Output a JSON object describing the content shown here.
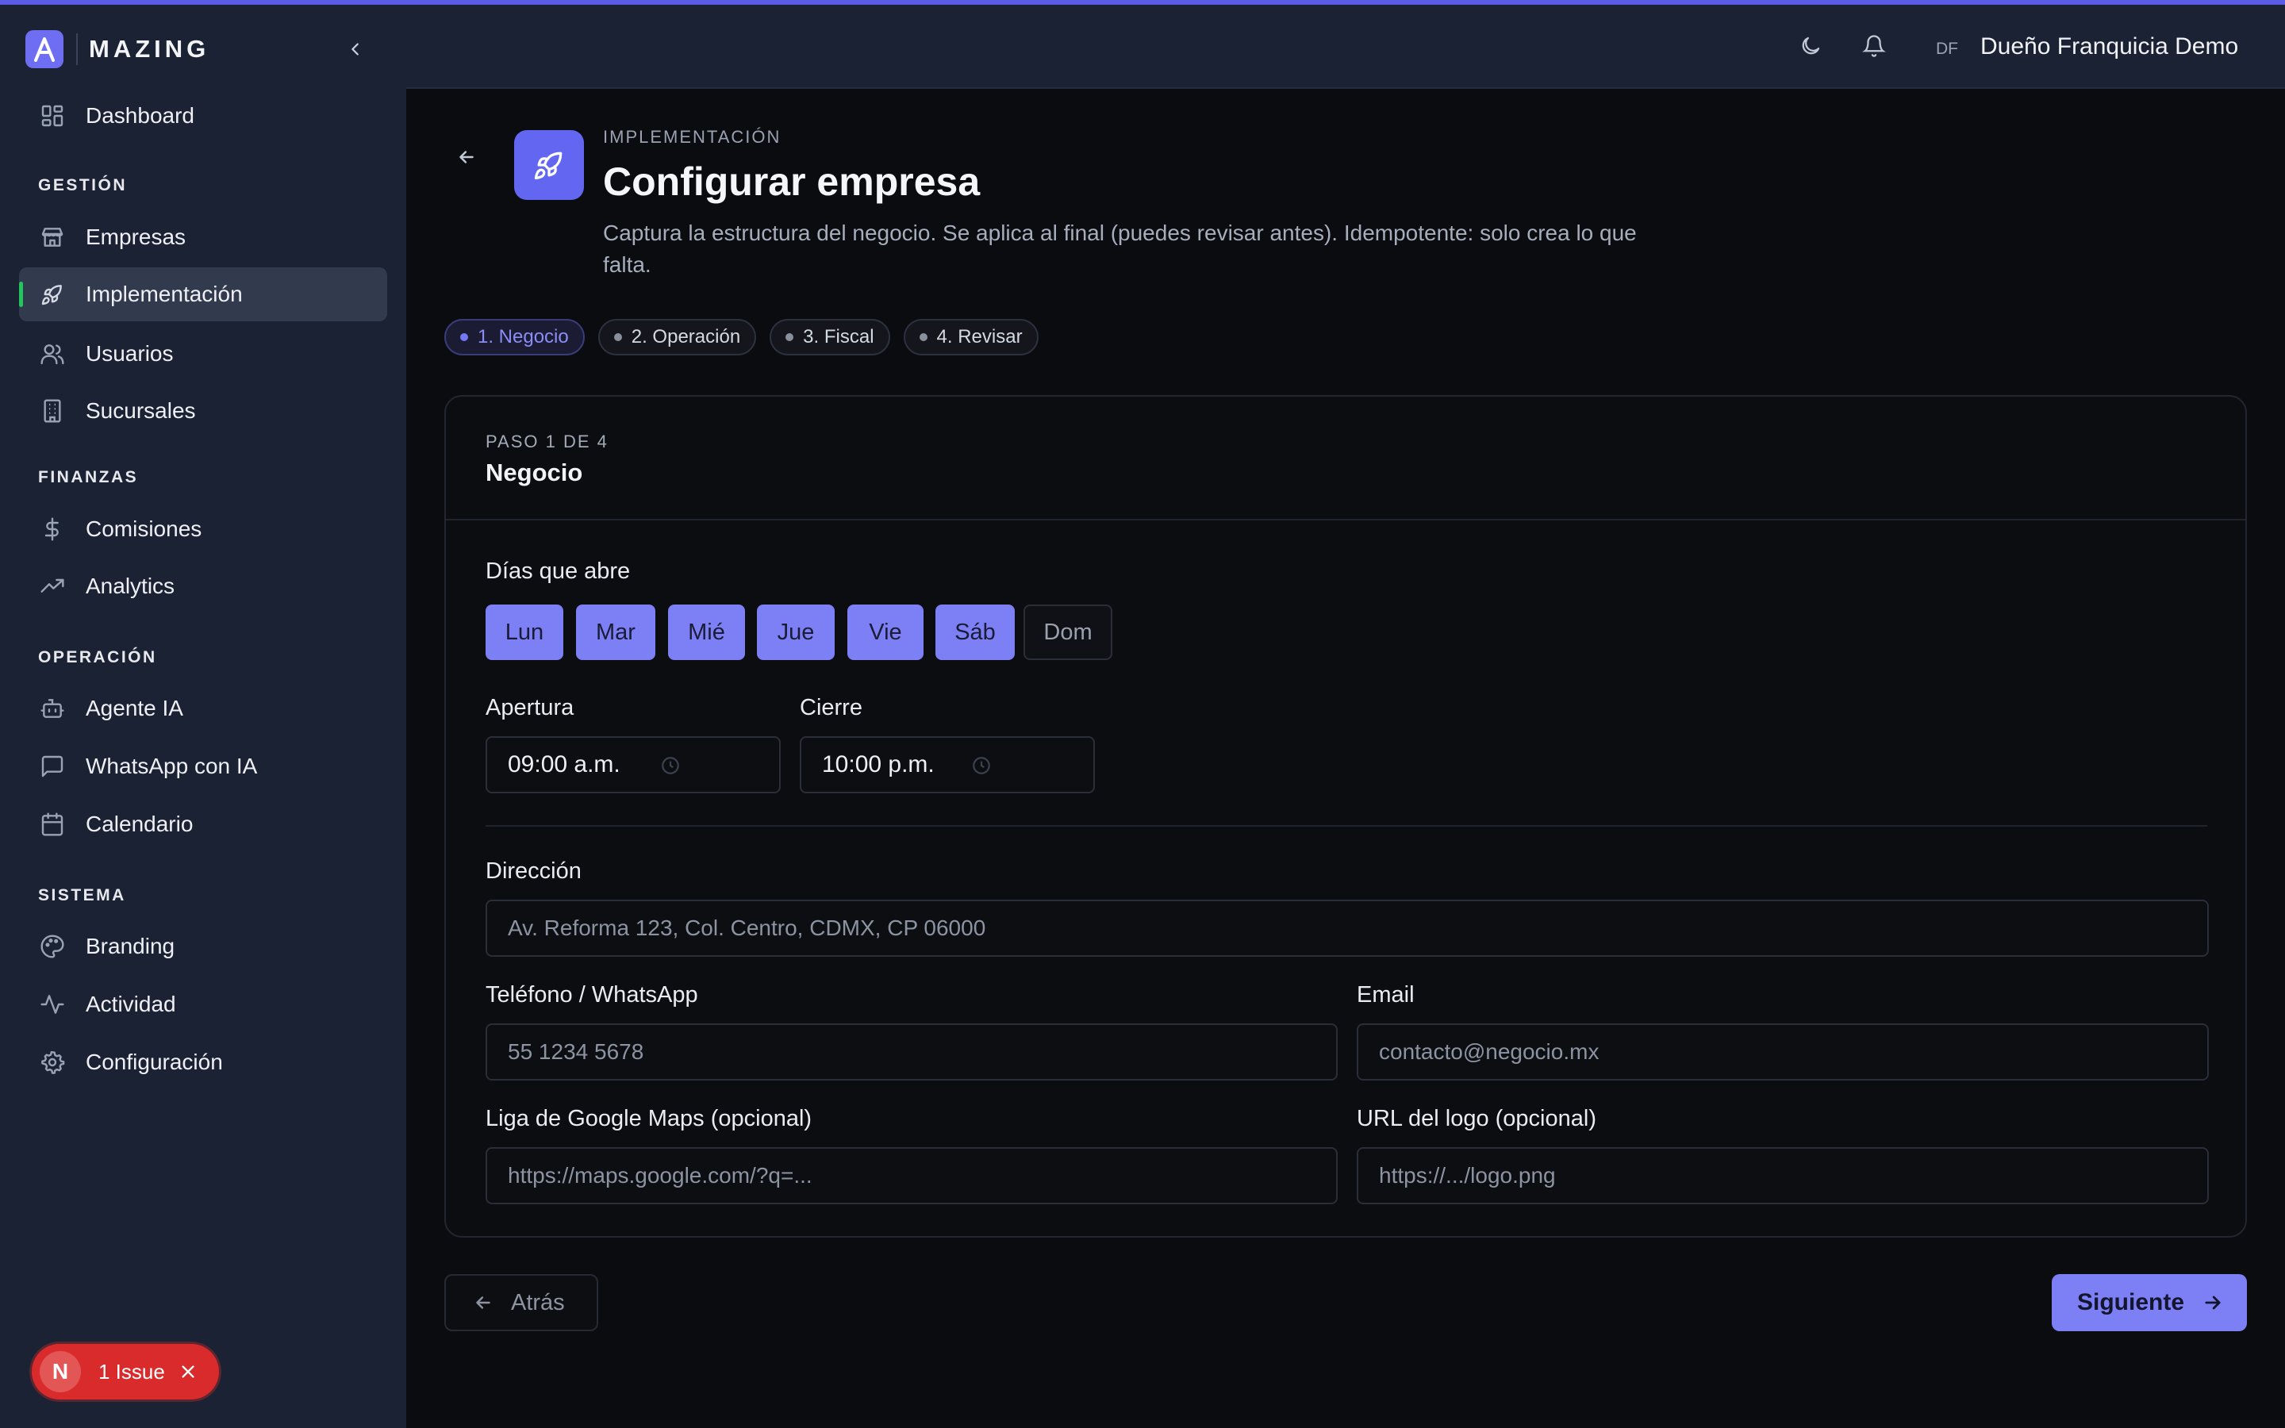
{
  "colors": {
    "accent": "#7d80f5",
    "sidebar_bg": "#1b2233",
    "active_indicator": "#22c55e",
    "issue_bg": "#d92b2b"
  },
  "brand": {
    "logo_letter": "A",
    "name": "MAZING"
  },
  "header": {
    "user_initials": "DF",
    "user_name": "Dueño Franquicia Demo"
  },
  "sidebar": {
    "items": [
      {
        "label": "Dashboard",
        "icon": "grid-icon"
      },
      {
        "label": "Empresas",
        "icon": "store-icon"
      },
      {
        "label": "Implementación",
        "icon": "rocket-icon"
      },
      {
        "label": "Usuarios",
        "icon": "users-icon"
      },
      {
        "label": "Sucursales",
        "icon": "building-icon"
      },
      {
        "label": "Comisiones",
        "icon": "dollar-icon"
      },
      {
        "label": "Analytics",
        "icon": "trending-up-icon"
      },
      {
        "label": "Agente IA",
        "icon": "bot-icon"
      },
      {
        "label": "WhatsApp con IA",
        "icon": "message-icon"
      },
      {
        "label": "Calendario",
        "icon": "calendar-icon"
      },
      {
        "label": "Branding",
        "icon": "palette-icon"
      },
      {
        "label": "Actividad",
        "icon": "activity-icon"
      },
      {
        "label": "Configuración",
        "icon": "gear-icon"
      }
    ],
    "sections": [
      "GESTIÓN",
      "FINANZAS",
      "OPERACIÓN",
      "SISTEMA"
    ],
    "active_item": "Implementación"
  },
  "issue": {
    "letter": "N",
    "label": "1 Issue"
  },
  "page": {
    "eyebrow": "IMPLEMENTACIÓN",
    "title": "Configurar empresa",
    "description": "Captura la estructura del negocio. Se aplica al final (puedes revisar antes). Idempotente: solo crea lo que falta."
  },
  "steps": [
    "1. Negocio",
    "2. Operación",
    "3. Fiscal",
    "4. Revisar"
  ],
  "current_step": 1,
  "card": {
    "eyebrow": "PASO 1 DE 4",
    "title": "Negocio",
    "days_label": "Días que abre",
    "days": [
      {
        "label": "Lun",
        "selected": true
      },
      {
        "label": "Mar",
        "selected": true
      },
      {
        "label": "Mié",
        "selected": true
      },
      {
        "label": "Jue",
        "selected": true
      },
      {
        "label": "Vie",
        "selected": true
      },
      {
        "label": "Sáb",
        "selected": true
      },
      {
        "label": "Dom",
        "selected": false
      }
    ],
    "opening_label": "Apertura",
    "opening_value": "09:00 a.m.",
    "closing_label": "Cierre",
    "closing_value": "10:00 p.m.",
    "address_label": "Dirección",
    "address_placeholder": "Av. Reforma 123, Col. Centro, CDMX, CP 06000",
    "phone_label": "Teléfono / WhatsApp",
    "phone_placeholder": "55 1234 5678",
    "email_label": "Email",
    "email_placeholder": "contacto@negocio.mx",
    "maps_label": "Liga de Google Maps (opcional)",
    "maps_placeholder": "https://maps.google.com/?q=...",
    "logo_label": "URL del logo (opcional)",
    "logo_placeholder": "https://.../logo.png"
  },
  "footer": {
    "back_label": "Atrás",
    "next_label": "Siguiente"
  }
}
